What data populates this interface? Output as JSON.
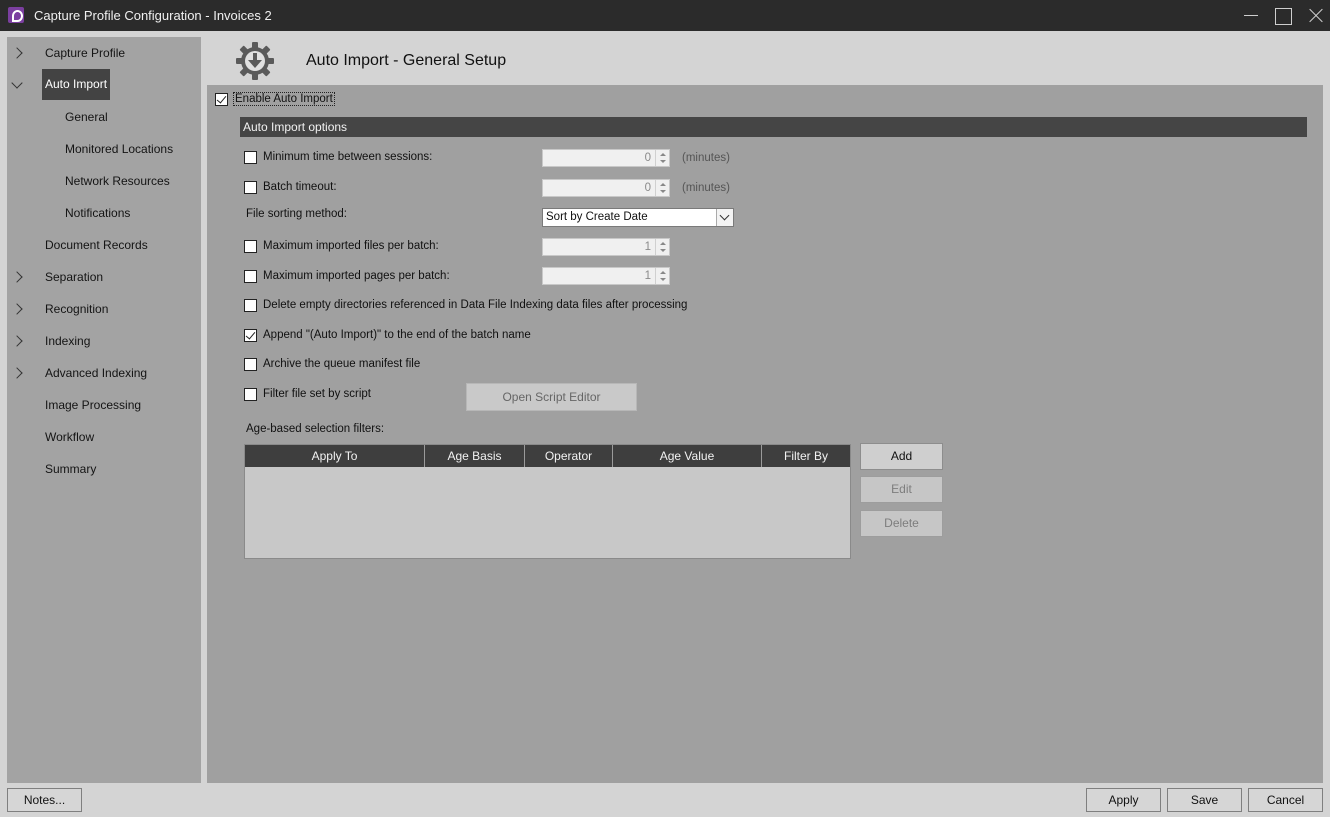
{
  "window": {
    "title": "Capture Profile Configuration - Invoices 2",
    "icon": "app-logo-icon",
    "controls": [
      "minimize-icon",
      "maximize-icon",
      "close-icon"
    ]
  },
  "sidebar": {
    "items": [
      {
        "label": "Capture Profile",
        "expander": "right"
      },
      {
        "label": "Auto Import",
        "expander": "down",
        "selected": true
      },
      {
        "label": "General",
        "level": 2
      },
      {
        "label": "Monitored Locations",
        "level": 2
      },
      {
        "label": "Network Resources",
        "level": 2
      },
      {
        "label": "Notifications",
        "level": 2
      },
      {
        "label": "Document Records"
      },
      {
        "label": "Separation",
        "expander": "right"
      },
      {
        "label": "Recognition",
        "expander": "right"
      },
      {
        "label": "Indexing",
        "expander": "right"
      },
      {
        "label": "Advanced Indexing",
        "expander": "right"
      },
      {
        "label": "Image Processing"
      },
      {
        "label": "Workflow"
      },
      {
        "label": "Summary"
      }
    ]
  },
  "header": {
    "title": "Auto Import - General Setup",
    "icon": "gear-download-icon"
  },
  "main": {
    "enable_auto_import": {
      "label": "Enable Auto Import",
      "checked": true
    },
    "section_title": "Auto Import options",
    "min_time": {
      "label": "Minimum time between sessions:",
      "checked": false,
      "value": "0",
      "unit": "(minutes)"
    },
    "batch_timeout": {
      "label": "Batch timeout:",
      "checked": false,
      "value": "0",
      "unit": "(minutes)"
    },
    "sorting": {
      "label": "File sorting method:",
      "value": "Sort by Create Date"
    },
    "max_files": {
      "label": "Maximum imported files per batch:",
      "checked": false,
      "value": "1"
    },
    "max_pages": {
      "label": "Maximum imported pages per batch:",
      "checked": false,
      "value": "1"
    },
    "delete_empty": {
      "label": "Delete empty directories referenced in Data File Indexing data files after processing",
      "checked": false
    },
    "append_name": {
      "label": "Append \"(Auto Import)\" to the end of the batch name",
      "checked": true
    },
    "archive_manifest": {
      "label": "Archive the queue manifest file",
      "checked": false
    },
    "filter_script": {
      "label": "Filter file set by script",
      "checked": false,
      "button": "Open Script Editor"
    },
    "age_filters": {
      "label": "Age-based selection filters:",
      "columns": [
        "Apply To",
        "Age Basis",
        "Operator",
        "Age Value",
        "Filter By"
      ],
      "rows": [],
      "buttons": {
        "add": "Add",
        "edit": "Edit",
        "delete": "Delete"
      }
    }
  },
  "footer": {
    "notes": "Notes...",
    "apply": "Apply",
    "save": "Save",
    "cancel": "Cancel"
  }
}
